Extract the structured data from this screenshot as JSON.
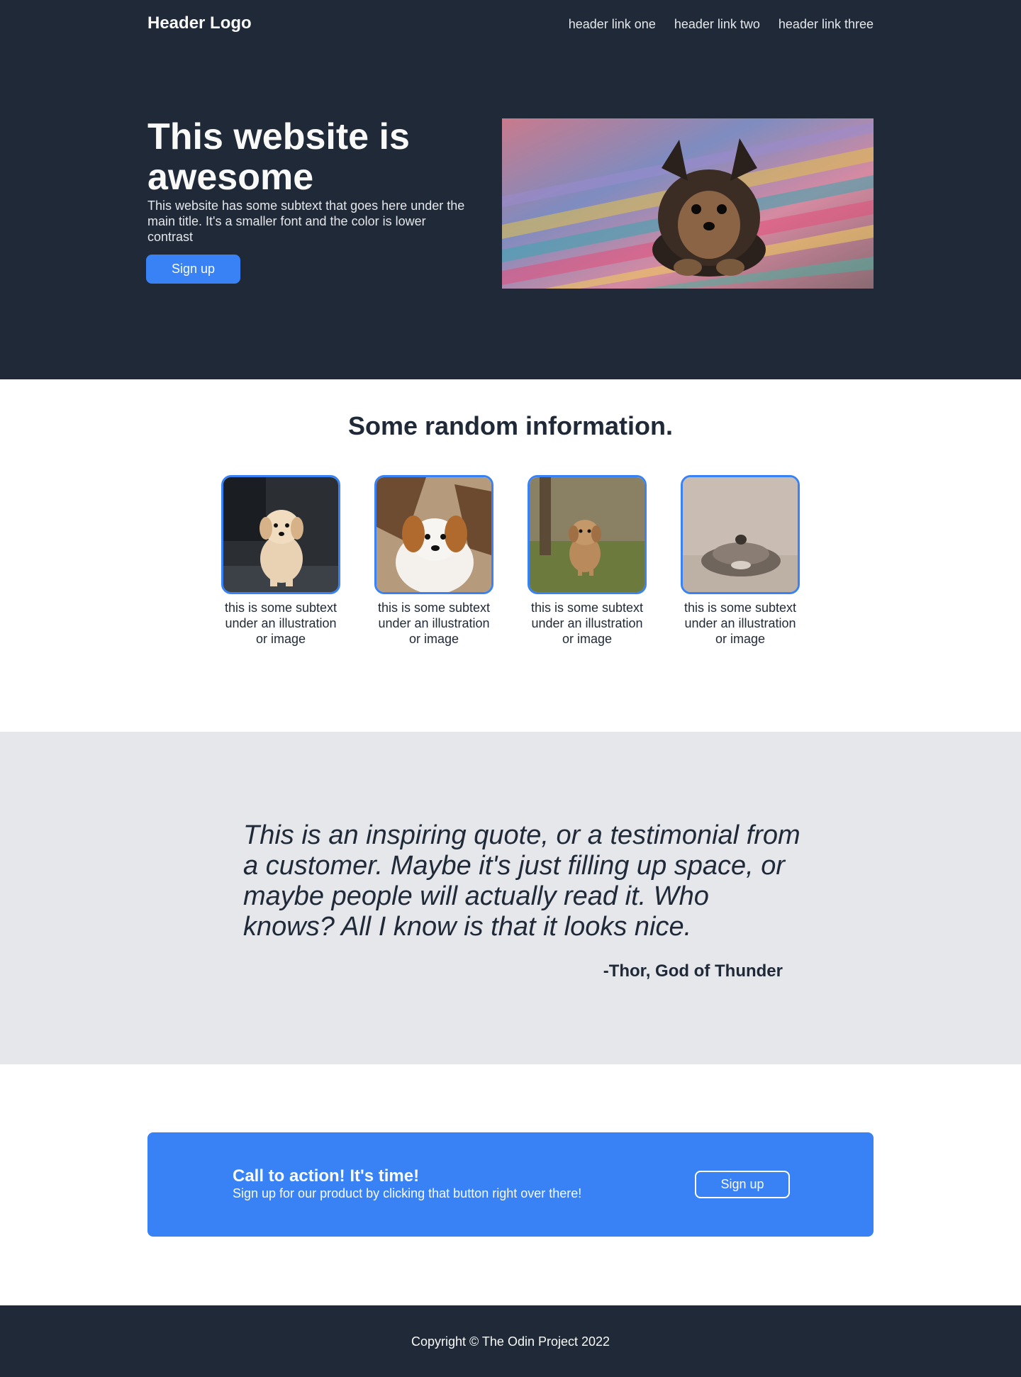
{
  "colors": {
    "dark": "#1f2937",
    "accent": "#3882f6",
    "light_text": "#f9faf8",
    "muted_text": "#e5e7eb",
    "quote_bg": "#e5e7eb"
  },
  "header": {
    "logo": "Header Logo",
    "links": [
      "header link one",
      "header link two",
      "header link three"
    ]
  },
  "hero": {
    "title": "This website is awesome",
    "subtext": "This website has some subtext that goes here under the main title. It's a smaller font and the color is lower contrast",
    "button_label": "Sign up",
    "image_icon": "puppy-photo"
  },
  "info": {
    "title": "Some random information.",
    "cards": [
      {
        "text": "this is some subtext under an illustration or image",
        "image_icon": "golden-puppy-photo"
      },
      {
        "text": "this is some subtext under an illustration or image",
        "image_icon": "spaniel-puppy-photo"
      },
      {
        "text": "this is some subtext under an illustration or image",
        "image_icon": "terrier-puppy-photo"
      },
      {
        "text": "this is some subtext under an illustration or image",
        "image_icon": "sleeping-dog-photo"
      }
    ]
  },
  "quote": {
    "text": "This is an inspiring quote, or a testimonial from a customer. Maybe it's just filling up space, or maybe people will actually read it. Who knows? All I know is that it looks nice.",
    "author": "-Thor, God of Thunder"
  },
  "cta": {
    "title": "Call to action! It's time!",
    "subtext": "Sign up for our product by clicking that button right over there!",
    "button_label": "Sign up"
  },
  "footer": {
    "copyright": "Copyright © The Odin Project 2022"
  }
}
